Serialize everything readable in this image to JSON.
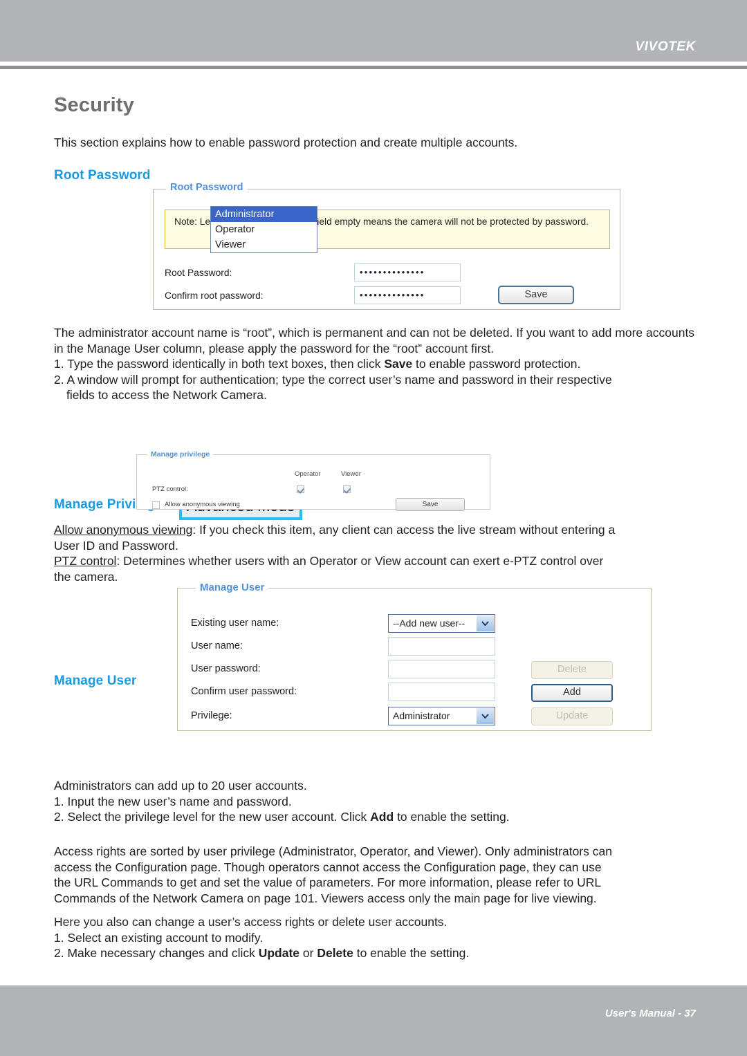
{
  "header": {
    "brand": "VIVOTEK"
  },
  "page": {
    "title": "Security",
    "intro": "This section explains how to enable password protection and create multiple accounts."
  },
  "root_password": {
    "heading": "Root Password",
    "panel_legend": "Root Password",
    "note": "Note: Leaving the root password field empty means the camera will not be protected by password.",
    "label_password": "Root Password:",
    "label_confirm": "Confirm root password:",
    "value_password": "••••••••••••••",
    "value_confirm": "••••••••••••••",
    "save_label": "Save"
  },
  "after_root_text": {
    "p1": "The administrator account name is “root”, which is permanent and can not be deleted. If you want to add more accounts in the Manage User column, please apply the password for the “root” account first.",
    "item1_pre": "1. Type the password identically in both text boxes, then click ",
    "item1_bold": "Save",
    "item1_post": " to enable password protection.",
    "item2": "2. A window will prompt for authentication; type the correct user’s name and password in their respective",
    "item2_cont": "fields to access the Network Camera."
  },
  "manage_privilege": {
    "heading": "Manage Privilege",
    "badge": "Advanced Mode",
    "panel_legend": "Manage privilege",
    "col_operator": "Operator",
    "col_viewer": "Viewer",
    "row_ptz_label": "PTZ control:",
    "ptz_operator_checked": true,
    "ptz_viewer_checked": true,
    "anonymous_label": "Allow anonymous viewing",
    "anonymous_checked": false,
    "save_label": "Save"
  },
  "after_priv_text": {
    "l1_underline": "Allow anonymous viewing",
    "l1_rest": ": If you check this item, any client can access the live stream without entering a",
    "l2": "User ID and Password.",
    "l3_underline": "PTZ control",
    "l3_rest": ": Determines whether users with an Operator or View account can exert e-PTZ control over",
    "l4": "the camera."
  },
  "manage_user": {
    "heading": "Manage User",
    "panel_legend": "Manage User",
    "label_existing": "Existing user name:",
    "label_username": "User name:",
    "label_password": "User password:",
    "label_confirm": "Confirm user password:",
    "label_privilege": "Privilege:",
    "existing_value": "--Add new user--",
    "username_value": "",
    "password_value": "",
    "confirm_value": "",
    "privilege_value": "Administrator",
    "privilege_options": [
      "Administrator",
      "Operator",
      "Viewer"
    ],
    "privilege_selected_index": 0,
    "btn_delete": "Delete",
    "btn_add": "Add",
    "btn_update": "Update"
  },
  "after_user_text": {
    "l1": "Administrators can add up to 20 user accounts.",
    "l2": "1. Input the new user’s name and password.",
    "l3_pre": "2. Select the privilege level for the new user account. Click ",
    "l3_bold": "Add",
    "l3_post": " to enable the setting."
  },
  "access_rights_text": {
    "l1": "Access rights are sorted by user privilege (Administrator, Operator, and Viewer). Only administrators can",
    "l2": "access the Configuration page. Though operators cannot access the Configuration page, they can use",
    "l3": "the URL Commands to get and set the value of parameters. For more information, please refer to URL",
    "l4": "Commands of the Network Camera on page 101. Viewers access only the main page for live viewing."
  },
  "here_text": {
    "l1": "Here you also can change a user’s access rights or delete user accounts.",
    "l2": "1. Select an existing account to modify.",
    "l3_pre": "2. Make necessary changes and click ",
    "l3_bold1": "Update",
    "l3_mid": " or ",
    "l3_bold2": "Delete",
    "l3_post": " to enable the setting."
  },
  "footer": {
    "text": "User's Manual - 37"
  }
}
